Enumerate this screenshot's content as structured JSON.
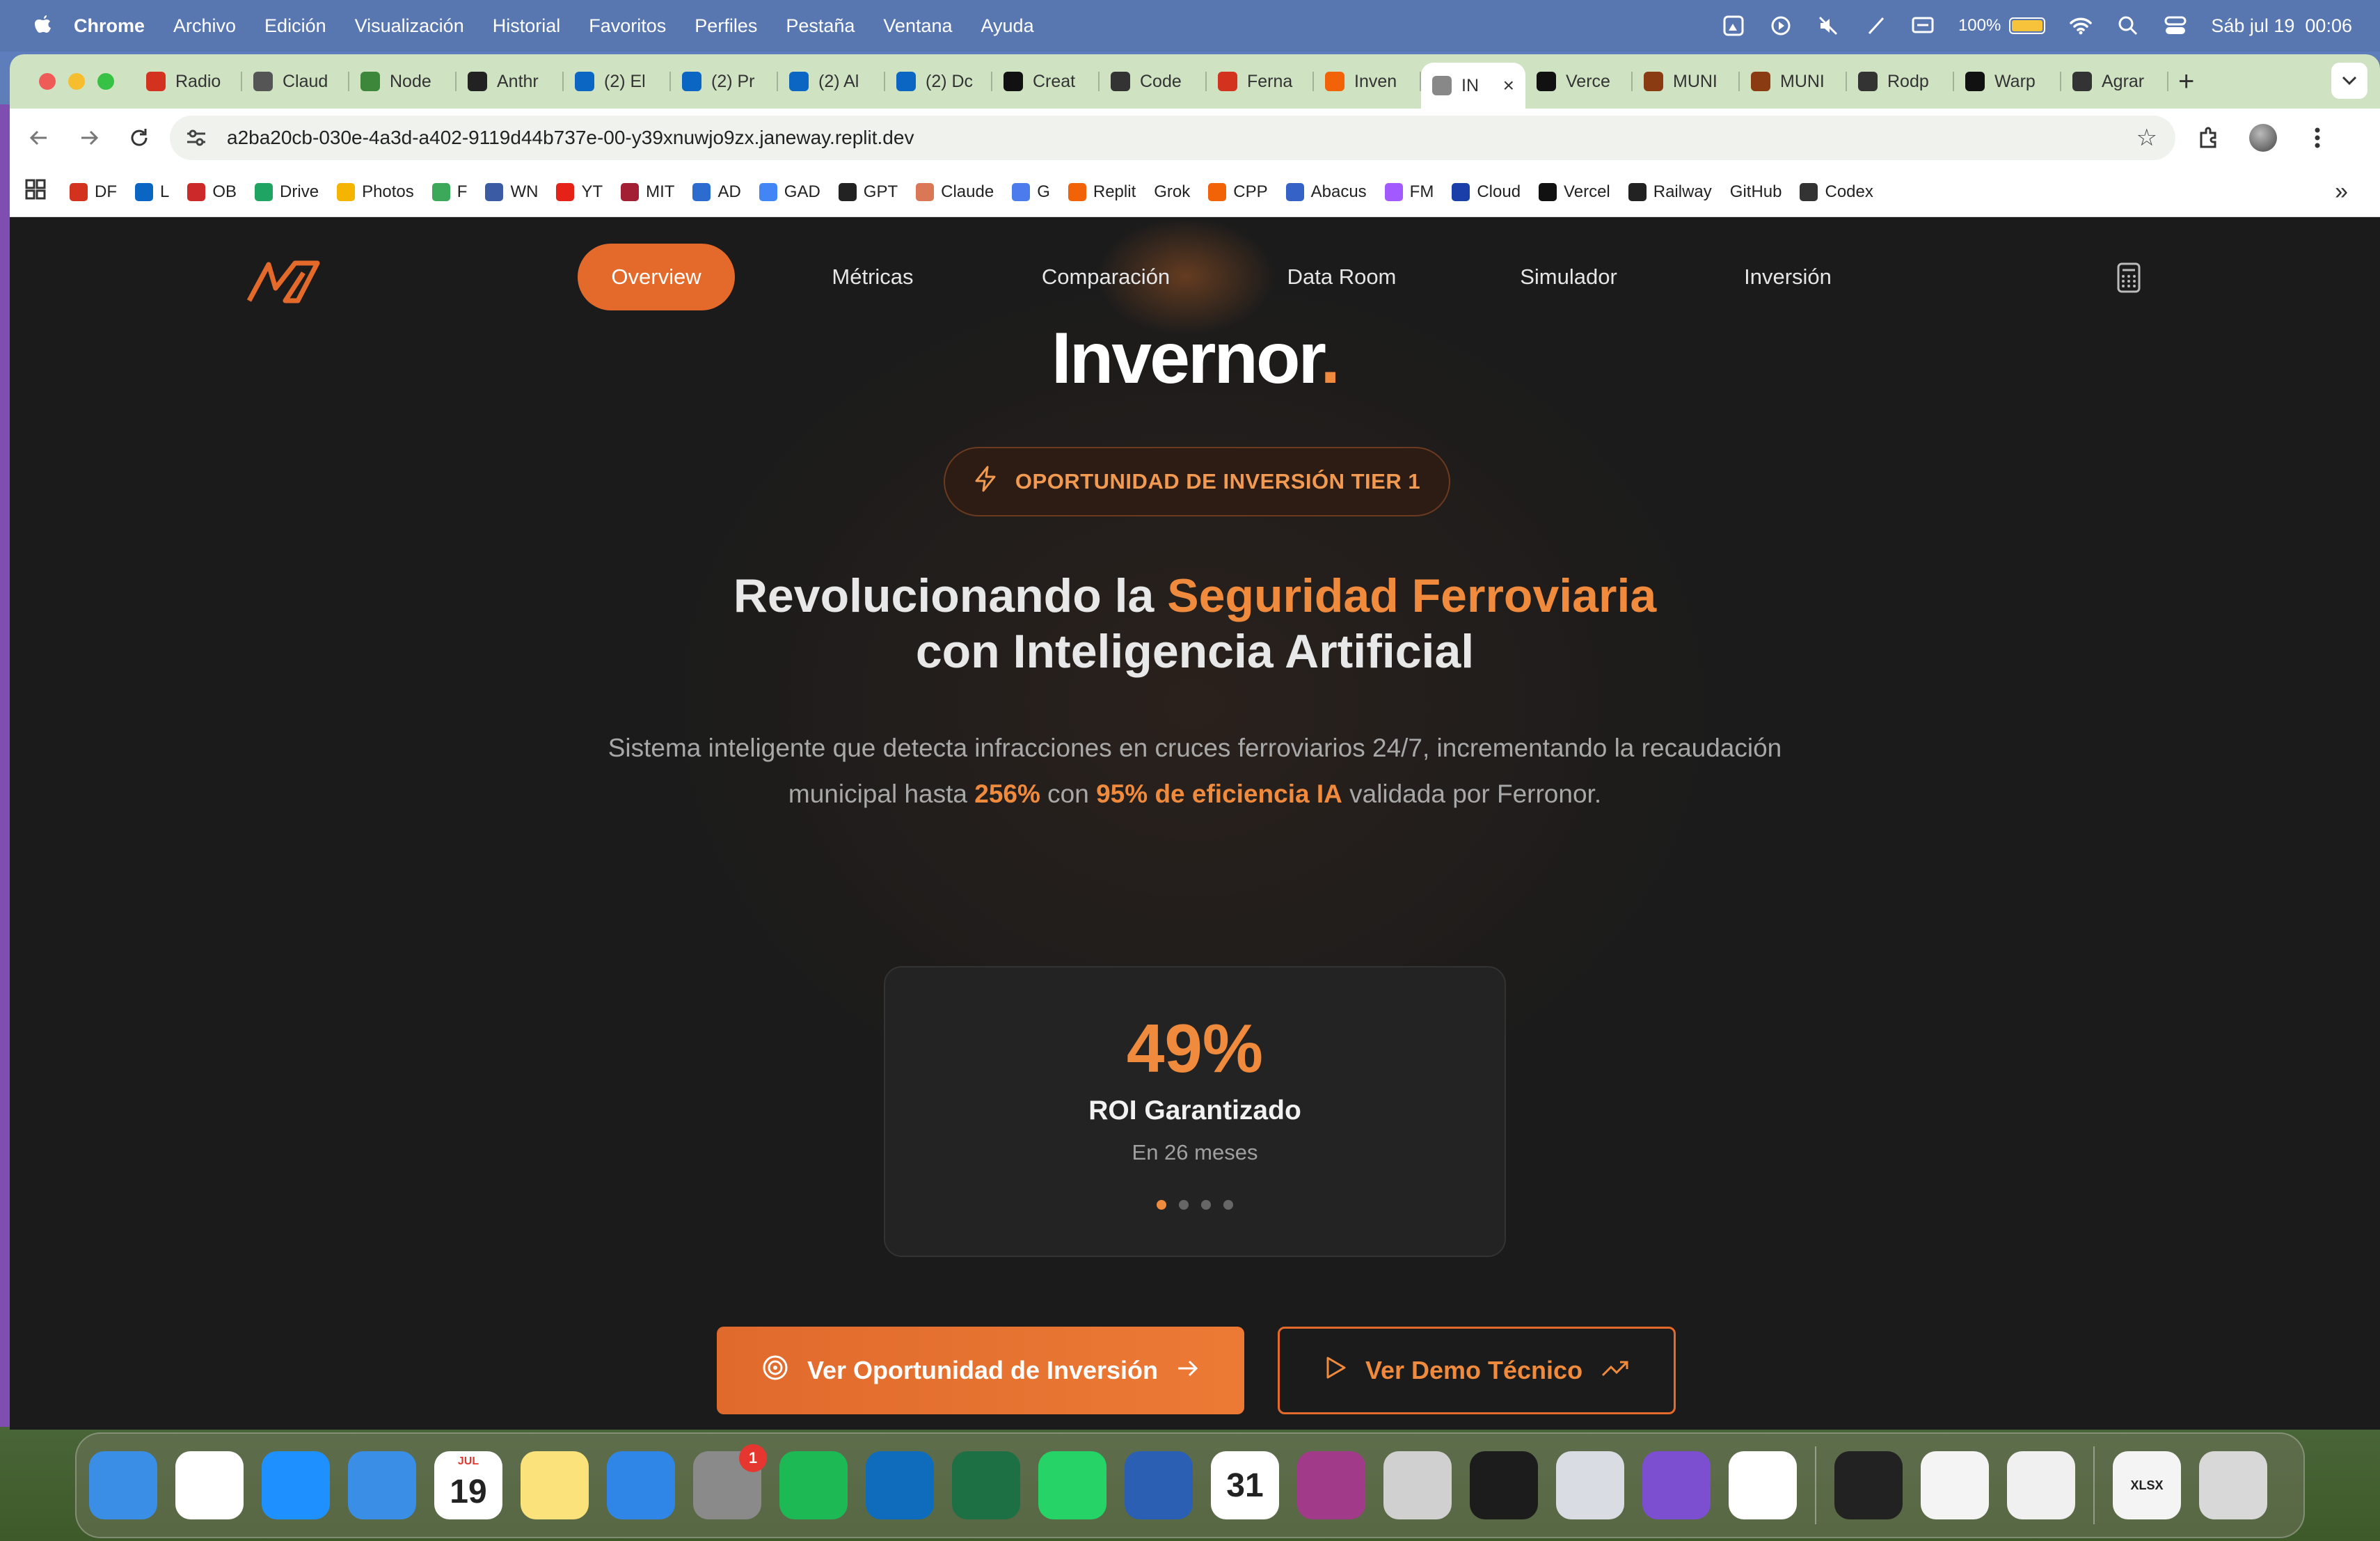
{
  "menubar": {
    "items": [
      "Chrome",
      "Archivo",
      "Edición",
      "Visualización",
      "Historial",
      "Favoritos",
      "Perfiles",
      "Pestaña",
      "Ventana",
      "Ayuda"
    ],
    "battery": "100%",
    "battery_level": 1.0,
    "datetime": "Sáb jul 19  00:06"
  },
  "tabs": [
    {
      "label": "Radio",
      "icon": "df-icon",
      "color": "#d3321f"
    },
    {
      "label": "Claud",
      "icon": "ai-icon",
      "color": "#555555"
    },
    {
      "label": "Node",
      "icon": "node-icon",
      "color": "#3c873a"
    },
    {
      "label": "Anthr",
      "icon": "anthropic-icon",
      "color": "#222222"
    },
    {
      "label": "(2) El",
      "icon": "linkedin-icon",
      "color": "#0a66c2"
    },
    {
      "label": "(2) Pr",
      "icon": "linkedin-icon",
      "color": "#0a66c2"
    },
    {
      "label": "(2) Al",
      "icon": "linkedin-icon",
      "color": "#0a66c2"
    },
    {
      "label": "(2) Dc",
      "icon": "linkedin-icon",
      "color": "#0a66c2"
    },
    {
      "label": "Creat",
      "icon": "v0-icon",
      "color": "#111111"
    },
    {
      "label": "Code",
      "icon": "codex-icon",
      "color": "#333333"
    },
    {
      "label": "Ferna",
      "icon": "df-icon",
      "color": "#d3321f"
    },
    {
      "label": "Inven",
      "icon": "replit-icon",
      "color": "#f26207"
    },
    {
      "label": "IN",
      "icon": "globe-icon",
      "color": "#888888",
      "active": true
    },
    {
      "label": "Verce",
      "icon": "vercel-icon",
      "color": "#111111"
    },
    {
      "label": "MUNI",
      "icon": "muni-icon",
      "color": "#8a3b12"
    },
    {
      "label": "MUNI",
      "icon": "muni-icon",
      "color": "#8a3b12"
    },
    {
      "label": "Rodp",
      "icon": "github-icon",
      "color": "#333333"
    },
    {
      "label": "Warp",
      "icon": "warp-icon",
      "color": "#111111"
    },
    {
      "label": "Agrar",
      "icon": "openai-icon",
      "color": "#333333"
    }
  ],
  "address": {
    "url": "a2ba20cb-030e-4a3d-a402-9119d44b737e-00-y39xnuwjo9zx.janeway.replit.dev"
  },
  "bookmarks": [
    {
      "label": "DF",
      "color": "#d3321f"
    },
    {
      "label": "L",
      "color": "#0a66c2"
    },
    {
      "label": "OB",
      "color": "#cc2a2a"
    },
    {
      "label": "Drive",
      "color": "#1fa463"
    },
    {
      "label": "Photos",
      "color": "#f4b400"
    },
    {
      "label": "F",
      "color": "#3ca85a"
    },
    {
      "label": "WN",
      "color": "#3b5ba5"
    },
    {
      "label": "YT",
      "color": "#e62117"
    },
    {
      "label": "MIT",
      "color": "#a31f34"
    },
    {
      "label": "AD",
      "color": "#2d6ccf"
    },
    {
      "label": "GAD",
      "color": "#4285f4"
    },
    {
      "label": "GPT",
      "color": "#222222"
    },
    {
      "label": "Claude",
      "color": "#d97757"
    },
    {
      "label": "G",
      "color": "#4b7bec"
    },
    {
      "label": "Replit",
      "color": "#f26207"
    },
    {
      "label": "Grok",
      "color": "#ffffff"
    },
    {
      "label": "CPP",
      "color": "#f26207"
    },
    {
      "label": "Abacus",
      "color": "#3462c6"
    },
    {
      "label": "FM",
      "color": "#a259ff"
    },
    {
      "label": "Cloud",
      "color": "#1a3fa8"
    },
    {
      "label": "Vercel",
      "color": "#111111"
    },
    {
      "label": "Railway",
      "color": "#222222"
    },
    {
      "label": "GitHub",
      "color": "#ffffff"
    },
    {
      "label": "Codex",
      "color": "#333333"
    }
  ],
  "site": {
    "nav": [
      "Overview",
      "Métricas",
      "Comparación",
      "Data Room",
      "Simulador",
      "Inversión"
    ],
    "active_nav": "Overview",
    "brand": "Invernor",
    "brand_dot": ".",
    "badge": "OPORTUNIDAD DE INVERSIÓN TIER 1",
    "headline_a": "Revolucionando la ",
    "headline_highlight": "Seguridad Ferroviaria",
    "headline_b": "con Inteligencia Artificial",
    "sub_1": "Sistema inteligente que detecta infracciones en cruces ferroviarios 24/7, incrementando la recaudación",
    "sub_2a": "municipal hasta ",
    "sub_2b": "256%",
    "sub_2c": " con ",
    "sub_2d": "95% de eficiencia IA",
    "sub_2e": " validada por Ferronor.",
    "card": {
      "value": "49%",
      "label": "ROI Garantizado",
      "period": "En 26 meses",
      "slides": 4,
      "active_slide": 0
    },
    "cta_primary": "Ver Oportunidad de Inversión",
    "cta_secondary": "Ver Demo Técnico",
    "accent": "#e36a2a"
  },
  "dock": [
    {
      "name": "finder-icon",
      "label": "",
      "color": "#3a8ee6"
    },
    {
      "name": "chrome-icon",
      "label": "",
      "color": "#ffffff"
    },
    {
      "name": "safari-icon",
      "label": "",
      "color": "#1e90ff"
    },
    {
      "name": "mail-icon",
      "label": "",
      "color": "#3a8ee6"
    },
    {
      "name": "calendar-icon",
      "label": "19",
      "month": "JUL",
      "color": "#ffffff"
    },
    {
      "name": "notes-icon",
      "label": "",
      "color": "#fbe27a"
    },
    {
      "name": "keynote-icon",
      "label": "",
      "color": "#2f86e6"
    },
    {
      "name": "system-settings-icon",
      "label": "",
      "color": "#8a8a8a",
      "badge": "1"
    },
    {
      "name": "spotify-icon",
      "label": "",
      "color": "#1db954"
    },
    {
      "name": "outlook-icon",
      "label": "",
      "color": "#0f6cbd"
    },
    {
      "name": "excel-icon",
      "label": "",
      "color": "#1d7044"
    },
    {
      "name": "whatsapp-icon",
      "label": "",
      "color": "#25d366"
    },
    {
      "name": "word-icon",
      "label": "",
      "color": "#2b5fb4"
    },
    {
      "name": "calendar-31-icon",
      "label": "31",
      "color": "#ffffff"
    },
    {
      "name": "circle-app-icon",
      "label": "",
      "color": "#a23a8a"
    },
    {
      "name": "iphone-mirroring-icon",
      "label": "",
      "color": "#d0d0d0"
    },
    {
      "name": "replit-icon",
      "label": "",
      "color": "#1c1c1c"
    },
    {
      "name": "parallels-icon",
      "label": "",
      "color": "#d9dde3"
    },
    {
      "name": "github-desktop-icon",
      "label": "",
      "color": "#7b4fd0"
    },
    {
      "name": "vscode-icon",
      "label": "",
      "color": "#ffffff"
    },
    {
      "name": "terminal-icon",
      "label": "",
      "color": "#222222"
    },
    {
      "name": "textedit-icon",
      "label": "",
      "color": "#f4f4f4"
    },
    {
      "name": "passwords-icon",
      "label": "",
      "color": "#f0f0f0"
    },
    {
      "name": "xlsx-file-icon",
      "label": "XLSX",
      "color": "#f4f4f4"
    },
    {
      "name": "trash-icon",
      "label": "",
      "color": "#d8d8d8"
    }
  ]
}
